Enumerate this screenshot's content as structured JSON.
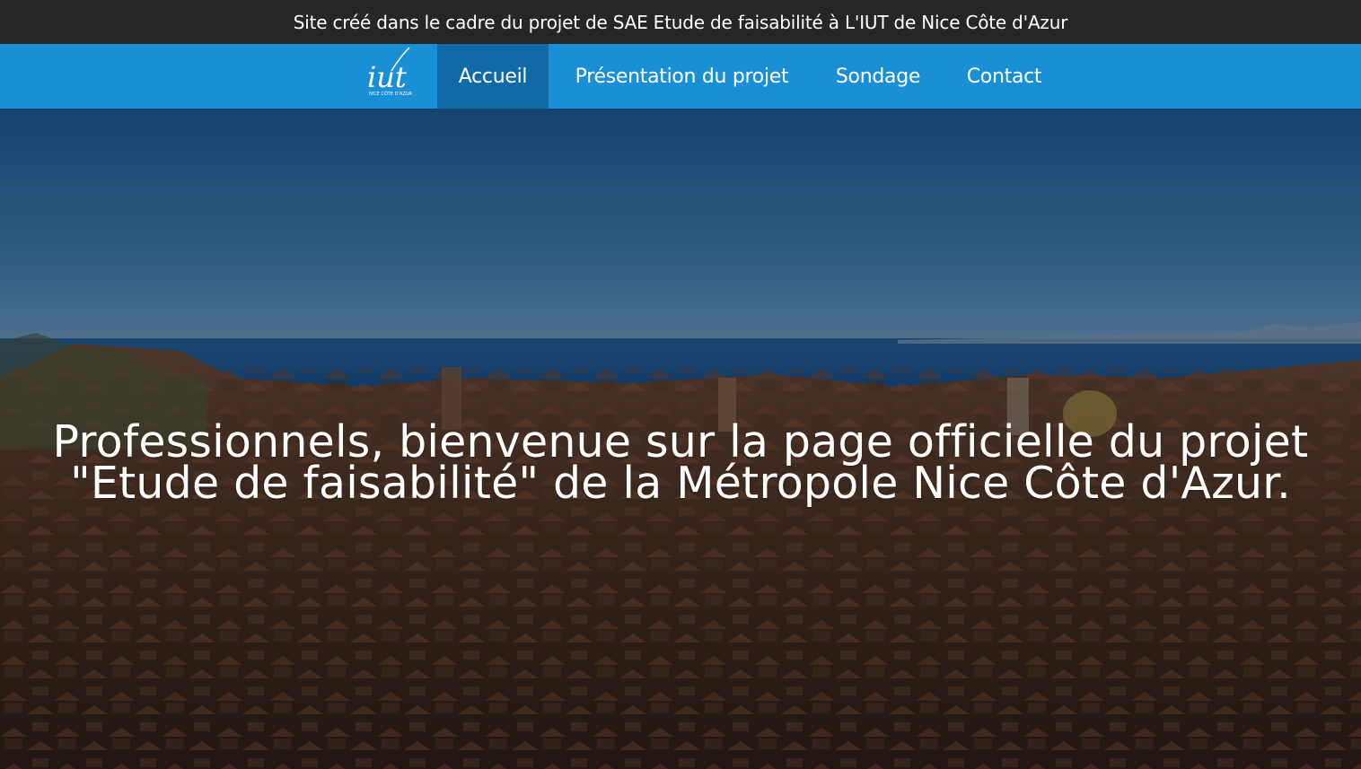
{
  "banner": {
    "text": "Site créé dans le cadre du projet de SAE Etude de faisabilité à L'IUT de Nice Côte d'Azur"
  },
  "nav": {
    "logo_icon": "iut-nice-cote-dazur-logo",
    "logo_text": "iut",
    "logo_subtext": "NICE CÔTE D'AZUR",
    "items": [
      {
        "label": "Accueil",
        "active": true
      },
      {
        "label": "Présentation du projet",
        "active": false
      },
      {
        "label": "Sondage",
        "active": false
      },
      {
        "label": "Contact",
        "active": false
      }
    ]
  },
  "hero": {
    "image": "nice-city-rooftops-sea-photo",
    "title_line1": "Professionnels, bienvenue sur la page officielle du projet",
    "title_line2": "\"Etude de faisabilité\" de la Métropole Nice Côte d'Azur."
  },
  "colors": {
    "banner_bg": "#262626",
    "nav_bg": "#1a8fd6",
    "nav_active_bg": "#0f6aa6",
    "text": "#ffffff"
  }
}
